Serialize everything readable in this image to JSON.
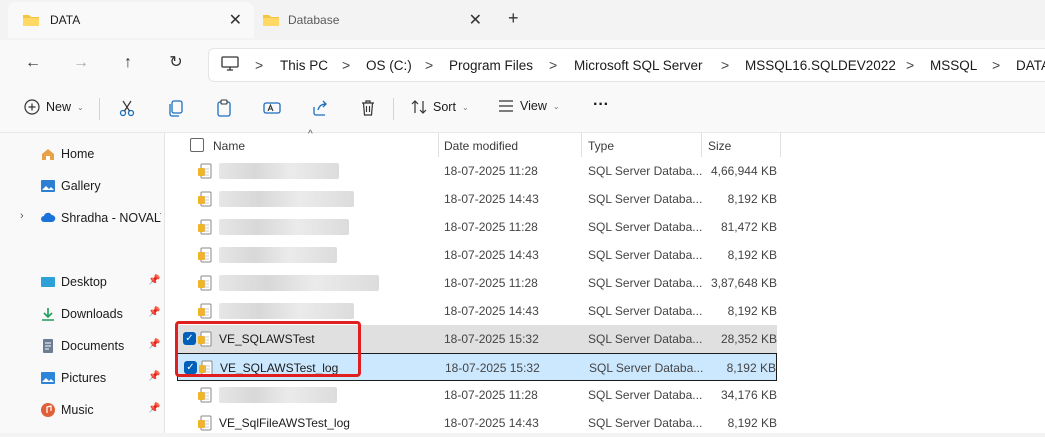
{
  "tabs": [
    {
      "label": "DATA",
      "close": "✕"
    },
    {
      "label": "Database",
      "close": "✕"
    }
  ],
  "new_tab": "+",
  "nav": {
    "back": "←",
    "forward": "→",
    "up": "↑",
    "refresh": "↻"
  },
  "breadcrumb": [
    "This PC",
    "OS (C:)",
    "Program Files",
    "Microsoft SQL Server",
    "MSSQL16.SQLDEV2022",
    "MSSQL",
    "DATA"
  ],
  "breadcrumb_sep": ">",
  "toolbar": {
    "new_label": "New",
    "sort_label": "Sort",
    "view_label": "View",
    "more": "···"
  },
  "sidebar": {
    "items": [
      {
        "label": "Home",
        "icon": "home-icon"
      },
      {
        "label": "Gallery",
        "icon": "gallery-icon"
      },
      {
        "label": "Shradha - NOVALYS",
        "icon": "cloud-icon"
      },
      {
        "label": "Desktop",
        "icon": "desktop-icon"
      },
      {
        "label": "Downloads",
        "icon": "download-icon"
      },
      {
        "label": "Documents",
        "icon": "document-icon"
      },
      {
        "label": "Pictures",
        "icon": "picture-icon"
      },
      {
        "label": "Music",
        "icon": "music-icon"
      }
    ]
  },
  "columns": {
    "name": "Name",
    "date": "Date modified",
    "type": "Type",
    "size": "Size"
  },
  "files": [
    {
      "name": "",
      "date": "18-07-2025 11:28",
      "type": "SQL Server Databa...",
      "size": "4,66,944 KB"
    },
    {
      "name": "",
      "date": "18-07-2025 14:43",
      "type": "SQL Server Databa...",
      "size": "8,192 KB"
    },
    {
      "name": "",
      "date": "18-07-2025 11:28",
      "type": "SQL Server Databa...",
      "size": "81,472 KB"
    },
    {
      "name": "",
      "date": "18-07-2025 14:43",
      "type": "SQL Server Databa...",
      "size": "8,192 KB"
    },
    {
      "name": "",
      "date": "18-07-2025 11:28",
      "type": "SQL Server Databa...",
      "size": "3,87,648 KB"
    },
    {
      "name": "",
      "date": "18-07-2025 14:43",
      "type": "SQL Server Databa...",
      "size": "8,192 KB"
    },
    {
      "name": "VE_SQLAWSTest",
      "date": "18-07-2025 15:32",
      "type": "SQL Server Databa...",
      "size": "28,352 KB"
    },
    {
      "name": "VE_SQLAWSTest_log",
      "date": "18-07-2025 15:32",
      "type": "SQL Server Databa...",
      "size": "8,192 KB"
    },
    {
      "name": "",
      "date": "18-07-2025 11:28",
      "type": "SQL Server Databa...",
      "size": "34,176 KB"
    },
    {
      "name": "VE_SqlFileAWSTest_log",
      "date": "18-07-2025 14:43",
      "type": "SQL Server Databa...",
      "size": "8,192 KB"
    }
  ],
  "colors": {
    "highlight": "#e02020",
    "selection": "#cce8ff",
    "accent": "#005fb8"
  }
}
